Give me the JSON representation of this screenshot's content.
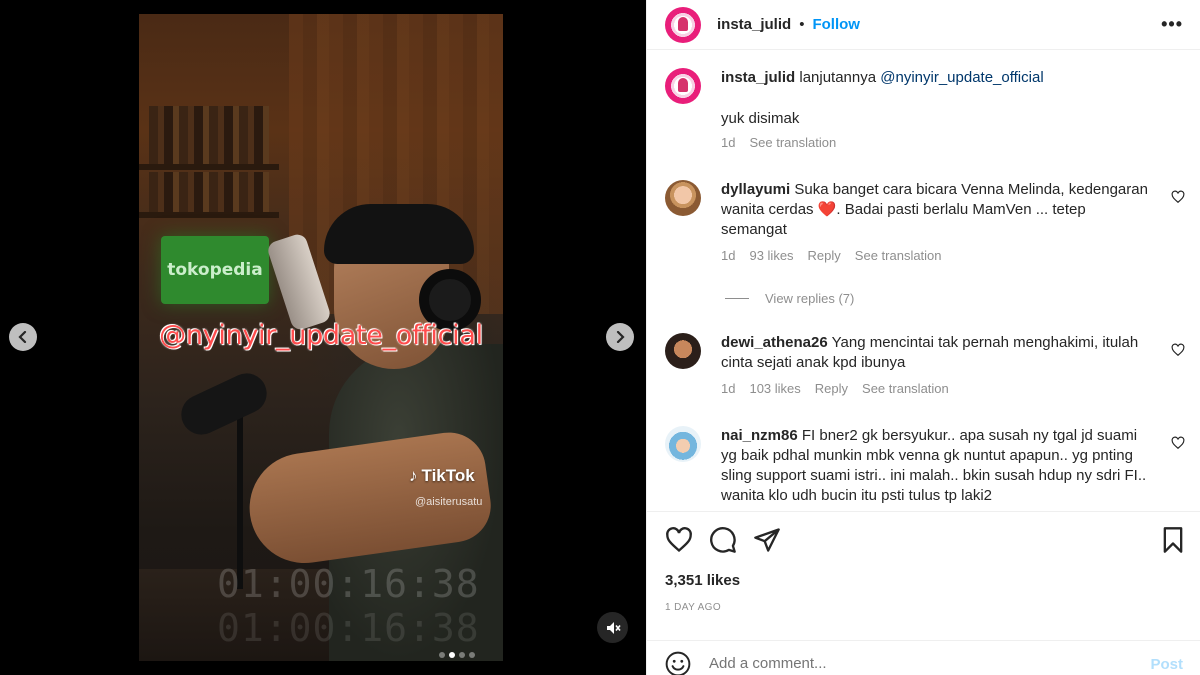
{
  "media": {
    "overlay_text": "@nyinyir_update_official",
    "sign_text": "tokopedia",
    "tiktok_label": "TikTok",
    "tiktok_handle": "@aisiterusatu",
    "timecode": "01:00:16:38",
    "carousel_total": 4,
    "carousel_active": 2
  },
  "post": {
    "username": "insta_julid",
    "separator": "•",
    "follow_label": "Follow",
    "more_label": "•••"
  },
  "caption": {
    "username": "insta_julid",
    "text": "lanjutannya",
    "mention": "@nyinyir_update_official",
    "line2": "yuk disimak",
    "time": "1d",
    "translate": "See translation"
  },
  "comments": [
    {
      "username": "dyllayumi",
      "text_a": "Suka banget cara bicara Venna Melinda, kedengaran wanita cerdas",
      "emoji": "❤️",
      "text_b": ". Badai pasti berlalu MamVen ... tetep semangat",
      "time": "1d",
      "likes": "93 likes",
      "reply": "Reply",
      "translate": "See translation"
    },
    {
      "username": "dewi_athena26",
      "text": "Yang mencintai tak pernah menghakimi, itulah cinta sejati anak kpd ibunya",
      "time": "1d",
      "likes": "103 likes",
      "reply": "Reply",
      "translate": "See translation"
    },
    {
      "username": "nai_nzm86",
      "text": "FI bner2 gk bersyukur.. apa susah ny tgal jd suami yg baik pdhal munkin mbk venna gk nuntut apapun.. yg pnting sling support suami istri.. ini malah.. bkin susah hdup ny sdri FI.. wanita klo udh bucin itu psti tulus tp laki2"
    }
  ],
  "view_replies": "View replies (7)",
  "likes_count": "3,351 likes",
  "posted_ago": "1 DAY AGO",
  "comment_box": {
    "placeholder": "Add a comment...",
    "post_label": "Post"
  },
  "colors": {
    "accent": "#0095f6",
    "post_disabled": "#b2dffc",
    "overlay_text": "#ff4d4d",
    "heart": "#e0245e"
  },
  "icons": {
    "prev": "chevron-left-icon",
    "next": "chevron-right-icon",
    "mute": "speaker-muted-icon",
    "like": "heart-icon",
    "comment": "comment-icon",
    "share": "paper-plane-icon",
    "save": "bookmark-icon",
    "emoji": "smile-icon"
  }
}
